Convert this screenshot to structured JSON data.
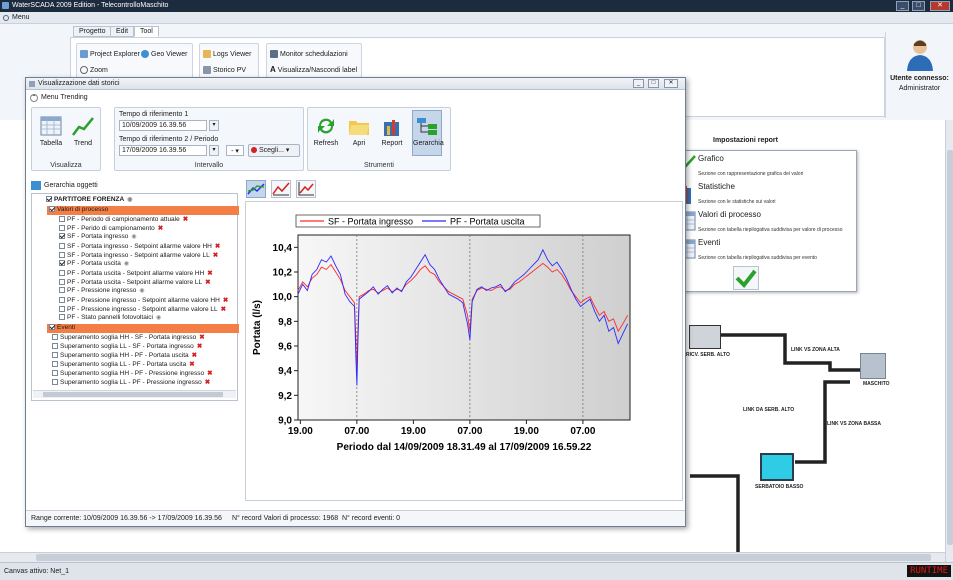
{
  "app": {
    "window_title": "WaterSCADA 2009 Edition - TelecontrolloMaschito",
    "menu_label": "Menu",
    "min_btn": "_",
    "max_btn": "□",
    "close_btn": "✕"
  },
  "ribbon": {
    "tabs": [
      "Progetto",
      "Edit",
      "Tool"
    ],
    "active_tab": "Tool",
    "items": {
      "project_explorer": "Project Explorer",
      "geo_viewer": "Geo Viewer",
      "zoom": "Zoom",
      "logs_viewer": "Logs Viewer",
      "storico_pv": "Storico PV",
      "monitor_schedulazioni": "Monitor schedulazioni",
      "visualizza_label": "Visualizza/Nascondi label"
    }
  },
  "user": {
    "label": "Utente connesso:",
    "name": "Administrator"
  },
  "report_icon_label": "Impostazioni report",
  "trend_window": {
    "title": "Visualizzazione dati storici",
    "menu_trending": "Menu Trending",
    "visualizza_group": "Visualizza",
    "btn_tabella": "Tabella",
    "btn_trend": "Trend",
    "intervallo_group": "Intervallo",
    "tempo1_label": "Tempo di riferimento 1",
    "tempo1_value": "10/09/2009 16.39.56",
    "tempo2_label": "Tempo di riferimento 2 / Periodo",
    "tempo2_value": "17/09/2009 16.39.56",
    "periodo_select": "-",
    "scegli_btn": "Scegli...",
    "strumenti_group": "Strumenti",
    "btn_refresh": "Refresh",
    "btn_apri": "Apri",
    "btn_report": "Report",
    "btn_gerarchia": "Gerarchia",
    "gerarchia_label": "Gerarchia oggetti",
    "status_range": "Range corrente: 10/09/2009 16.39.56 -> 17/09/2009 16.39.56",
    "status_record_pv": "N° record Valori di processo: 1968",
    "status_record_ev": "N° record eventi: 0"
  },
  "tree": {
    "root": "PARTITORE FORENZA",
    "section_valori": "Valori di processo",
    "valori_items": [
      {
        "label": "PF - Periodo di campionamento attuale",
        "checked": false,
        "mark": "x"
      },
      {
        "label": "PF - Perido di campionamento",
        "checked": false,
        "mark": "x"
      },
      {
        "label": "SF - Portata ingresso",
        "checked": true,
        "mark": "eye"
      },
      {
        "label": "SF - Portata ingresso - Setpoint allarme valore HH",
        "checked": false,
        "mark": "x"
      },
      {
        "label": "SF - Portata ingresso - Setpoint allarme valore LL",
        "checked": false,
        "mark": "x"
      },
      {
        "label": "PF - Portata uscita",
        "checked": true,
        "mark": "eye"
      },
      {
        "label": "PF - Portata uscita - Setpoint allarme valore HH",
        "checked": false,
        "mark": "x"
      },
      {
        "label": "PF - Portata uscita - Setpoint allarme valore LL",
        "checked": false,
        "mark": "x"
      },
      {
        "label": "PF - Pressione ingresso",
        "checked": false,
        "mark": "eye"
      },
      {
        "label": "PF - Pressione ingresso  - Setpoint allarme valore HH",
        "checked": false,
        "mark": "x"
      },
      {
        "label": "PF - Pressione ingresso - Setpoint allarme valore LL",
        "checked": false,
        "mark": "x"
      },
      {
        "label": "PF - Stato pannelli fotovoltaici",
        "checked": false,
        "mark": "eye"
      }
    ],
    "section_eventi": "Eventi",
    "eventi_items": [
      {
        "label": "Superamento soglia HH - SF - Portata ingresso",
        "mark": "x"
      },
      {
        "label": "Superamento soglia LL - SF - Portata ingresso",
        "mark": "x"
      },
      {
        "label": "Superamento soglia HH - PF - Portata uscita",
        "mark": "x"
      },
      {
        "label": "Superamento soglia LL - PF - Portata uscita",
        "mark": "x"
      },
      {
        "label": "Superamento soglia HH - PF - Pressione ingresso",
        "mark": "x"
      },
      {
        "label": "Superamento soglia LL - PF - Pressione ingresso",
        "mark": "x"
      }
    ]
  },
  "report_panel": {
    "rows": [
      {
        "title": "Grafico",
        "desc": "Sezione con rappresentazione grafica dei valori"
      },
      {
        "title": "Statistiche",
        "desc": "Sezione con le statistiche sui valori"
      },
      {
        "title": "Valori di processo",
        "desc": "Sezione con tabella riepilogativa suddivisa per valore di processo"
      },
      {
        "title": "Eventi",
        "desc": "Sezione con tabella riepilogativa suddivisa per evento"
      }
    ]
  },
  "diagram_labels": {
    "serb_alto": "RICV. SERB. ALTO",
    "link_zona_alta": "LINK VS ZONA ALTA",
    "maschito": "MASCHITO",
    "link_da_serb_alto": "LINK DA SERB. ALTO",
    "link_zona_bassa": "LINK VS ZONA BASSA",
    "serbatoio_basso": "SERBATOIO BASSO"
  },
  "status": {
    "canvas": "Canvas attivo: Net_1",
    "runtime": "RUNTIME"
  },
  "colors": {
    "series_sf": "#ff2a2a",
    "series_pf": "#2a2aff",
    "section_orange": "#f37f47",
    "title_dark": "#1d2b3f"
  },
  "chart_data": {
    "type": "line",
    "xlabel": "Periodo dal 14/09/2009 18.31.49 al 17/09/2009 16.59.22",
    "ylabel": "Portata (l/s)",
    "ylim": [
      9.0,
      10.5
    ],
    "yticks": [
      "9,0",
      "9,2",
      "9,4",
      "9,6",
      "9,8",
      "10,0",
      "10,2",
      "10,4"
    ],
    "x_tick_labels": [
      "19.00",
      "07.00",
      "19.00",
      "07.00",
      "19.00",
      "07.00"
    ],
    "x_tick_hours": [
      0.5,
      12.5,
      24.5,
      36.5,
      48.5,
      60.5
    ],
    "x_range_hours": [
      0,
      70.5
    ],
    "legend_position": "top",
    "series": [
      {
        "name": "SF - Portata ingresso",
        "color": "#ff2a2a",
        "points": [
          [
            0,
            10.05
          ],
          [
            1,
            10.12
          ],
          [
            2,
            10.08
          ],
          [
            3,
            10.15
          ],
          [
            4,
            10.18
          ],
          [
            5,
            10.24
          ],
          [
            6,
            10.22
          ],
          [
            7,
            10.26
          ],
          [
            8,
            10.2
          ],
          [
            9,
            10.14
          ],
          [
            10,
            10.05
          ],
          [
            11,
            10.0
          ],
          [
            12,
            9.95
          ],
          [
            12.3,
            9.65
          ],
          [
            12.5,
            9.35
          ],
          [
            12.7,
            9.7
          ],
          [
            13,
            10.0
          ],
          [
            14,
            10.02
          ],
          [
            15,
            10.05
          ],
          [
            16,
            10.06
          ],
          [
            17,
            10.03
          ],
          [
            18,
            10.05
          ],
          [
            19,
            10.07
          ],
          [
            20,
            10.04
          ],
          [
            21,
            10.06
          ],
          [
            22,
            10.05
          ],
          [
            23,
            10.1
          ],
          [
            24,
            10.13
          ],
          [
            25,
            10.17
          ],
          [
            26,
            10.22
          ],
          [
            27,
            10.25
          ],
          [
            28,
            10.2
          ],
          [
            29,
            10.18
          ],
          [
            30,
            10.12
          ],
          [
            31,
            10.08
          ],
          [
            32,
            10.04
          ],
          [
            33,
            10.02
          ],
          [
            34,
            10.0
          ],
          [
            35,
            9.98
          ],
          [
            36,
            9.85
          ],
          [
            36.5,
            9.72
          ],
          [
            37,
            9.98
          ],
          [
            38,
            10.05
          ],
          [
            39,
            10.07
          ],
          [
            40,
            10.06
          ],
          [
            41,
            10.05
          ],
          [
            42,
            10.07
          ],
          [
            43,
            10.08
          ],
          [
            44,
            10.05
          ],
          [
            45,
            10.06
          ],
          [
            46,
            10.1
          ],
          [
            47,
            10.12
          ],
          [
            48,
            10.15
          ],
          [
            49,
            10.18
          ],
          [
            50,
            10.21
          ],
          [
            51,
            10.24
          ],
          [
            52,
            10.27
          ],
          [
            53,
            10.24
          ],
          [
            54,
            10.2
          ],
          [
            55,
            10.22
          ],
          [
            56,
            10.18
          ],
          [
            57,
            10.12
          ],
          [
            58,
            10.05
          ],
          [
            59,
            10.0
          ],
          [
            60,
            9.95
          ],
          [
            61,
            9.98
          ],
          [
            62,
            10.0
          ],
          [
            63,
            9.92
          ],
          [
            64,
            9.85
          ],
          [
            65,
            9.88
          ],
          [
            66,
            9.8
          ],
          [
            67,
            9.82
          ],
          [
            68,
            9.72
          ],
          [
            69,
            9.78
          ],
          [
            70,
            9.85
          ]
        ]
      },
      {
        "name": "PF - Portata uscita",
        "color": "#2a2aff",
        "points": [
          [
            0,
            10.02
          ],
          [
            1,
            10.1
          ],
          [
            2,
            10.05
          ],
          [
            3,
            10.18
          ],
          [
            4,
            10.22
          ],
          [
            5,
            10.3
          ],
          [
            6,
            10.28
          ],
          [
            7,
            10.33
          ],
          [
            8,
            10.25
          ],
          [
            9,
            10.18
          ],
          [
            10,
            10.02
          ],
          [
            11,
            9.96
          ],
          [
            12,
            9.92
          ],
          [
            12.3,
            9.5
          ],
          [
            12.5,
            9.28
          ],
          [
            12.7,
            9.6
          ],
          [
            13,
            9.98
          ],
          [
            14,
            10.01
          ],
          [
            15,
            10.04
          ],
          [
            16,
            10.08
          ],
          [
            17,
            10.02
          ],
          [
            18,
            10.06
          ],
          [
            19,
            10.09
          ],
          [
            20,
            10.03
          ],
          [
            21,
            10.07
          ],
          [
            22,
            10.04
          ],
          [
            23,
            10.12
          ],
          [
            24,
            10.16
          ],
          [
            25,
            10.22
          ],
          [
            26,
            10.28
          ],
          [
            27,
            10.34
          ],
          [
            28,
            10.26
          ],
          [
            29,
            10.22
          ],
          [
            30,
            10.14
          ],
          [
            31,
            10.08
          ],
          [
            32,
            10.02
          ],
          [
            33,
            10.0
          ],
          [
            34,
            9.98
          ],
          [
            35,
            9.95
          ],
          [
            36,
            9.78
          ],
          [
            36.5,
            9.65
          ],
          [
            37,
            9.96
          ],
          [
            38,
            10.06
          ],
          [
            39,
            10.08
          ],
          [
            40,
            10.05
          ],
          [
            41,
            10.07
          ],
          [
            42,
            10.08
          ],
          [
            43,
            10.1
          ],
          [
            44,
            10.04
          ],
          [
            45,
            10.07
          ],
          [
            46,
            10.12
          ],
          [
            47,
            10.15
          ],
          [
            48,
            10.18
          ],
          [
            49,
            10.22
          ],
          [
            50,
            10.26
          ],
          [
            51,
            10.3
          ],
          [
            52,
            10.38
          ],
          [
            53,
            10.3
          ],
          [
            54,
            10.25
          ],
          [
            55,
            10.28
          ],
          [
            56,
            10.22
          ],
          [
            57,
            10.15
          ],
          [
            58,
            10.06
          ],
          [
            59,
            9.98
          ],
          [
            60,
            9.92
          ],
          [
            61,
            9.95
          ],
          [
            62,
            9.98
          ],
          [
            63,
            9.88
          ],
          [
            64,
            9.8
          ],
          [
            65,
            9.85
          ],
          [
            66,
            9.72
          ],
          [
            67,
            9.75
          ],
          [
            68,
            9.62
          ],
          [
            69,
            9.7
          ],
          [
            70,
            9.78
          ]
        ]
      }
    ]
  }
}
